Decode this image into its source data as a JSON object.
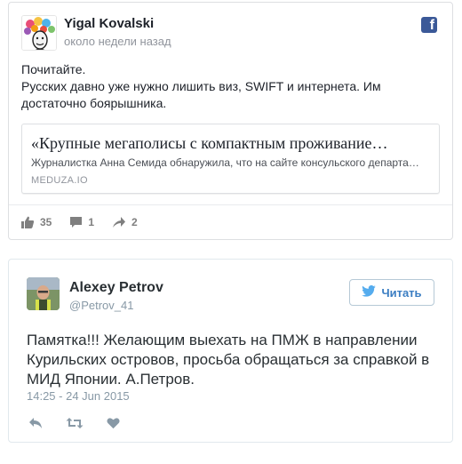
{
  "facebook_post": {
    "author": "Yigal Kovalski",
    "time": "около недели назад",
    "text": "Почитайте.\nРусских давно уже нужно лишить виз, SWIFT и интернета. Им достаточно боярышника.",
    "link": {
      "title": "«Крупные мегаполисы с компактным проживание…",
      "description": "Журналистка Анна Семида обнаружила, что на сайте консульского департа…",
      "domain": "MEDUZA.IO"
    },
    "likes": "35",
    "comments": "1",
    "shares": "2",
    "icons": {
      "platform": "facebook-icon",
      "like": "thumbs-up-icon",
      "comment": "comment-icon",
      "share": "share-icon"
    },
    "colors": {
      "brand": "#3b5998",
      "meta": "#90949c"
    }
  },
  "tweet": {
    "author": "Alexey Petrov",
    "handle": "@Petrov_41",
    "follow_label": "Читать",
    "text": "Памятка!!! Желающим выехать на ПМЖ в направлении Курильских островов, просьба обращаться за справкой в МИД Японии. А.Петров.",
    "date": "14:25 - 24 Jun 2015",
    "icons": {
      "bird": "twitter-bird-icon",
      "reply": "reply-icon",
      "retweet": "retweet-icon",
      "like": "heart-icon"
    },
    "colors": {
      "accent": "#3a7dc2",
      "meta": "#8899a6"
    }
  }
}
